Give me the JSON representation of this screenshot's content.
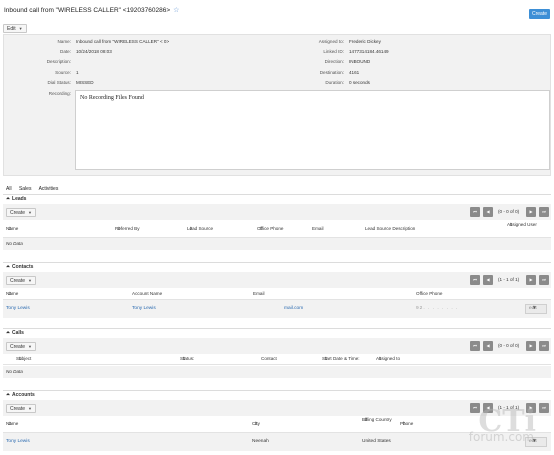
{
  "header": {
    "title": "Inbound call from \"WIRELESS CALLER\" <19203760286>",
    "create_label": "Create"
  },
  "actions": {
    "edit_label": "Edit"
  },
  "detail": {
    "left": [
      {
        "label": "Name:",
        "value": "Inbound call from \"WIRELESS CALLER\" <                    0>"
      },
      {
        "label": "Date:",
        "value": "10/24/2018 08:03"
      },
      {
        "label": "Description:",
        "value": ""
      },
      {
        "label": "Source:",
        "value": "1"
      },
      {
        "label": "Dial Status:",
        "value": "MISSED"
      }
    ],
    "right": [
      {
        "label": "Assigned to:",
        "value": "Frederic Dickey"
      },
      {
        "label": "Linked ID:",
        "value": "1477314184.46149"
      },
      {
        "label": "Direction:",
        "value": "INBOUND"
      },
      {
        "label": "Destination:",
        "value": "4161"
      },
      {
        "label": "Duration:",
        "value": "0 seconds"
      }
    ],
    "recording_label": "Recording:",
    "recording_text": "No Recording Files Found"
  },
  "tabs": [
    "All",
    "Sales",
    "Activities"
  ],
  "subpanels": {
    "leads": {
      "title": "Leads",
      "create_label": "Create",
      "count": "(0 - 0 of 0)",
      "columns": [
        "Name",
        "Referred By",
        "Lead Source",
        "Office Phone",
        "Email",
        "Lead Source Description",
        "Assigned User"
      ],
      "empty_text": "No Data"
    },
    "contacts": {
      "title": "Contacts",
      "create_label": "Create",
      "count": "(1 - 1 of 1)",
      "columns": [
        "Name",
        "Account Name",
        "Email",
        "Office Phone"
      ],
      "row": {
        "name": "Tony Lewis",
        "account": "Tony Lewis",
        "email": "mail.com",
        "phone": "92. . . . . . . .",
        "edit": "edit"
      }
    },
    "calls": {
      "title": "Calls",
      "create_label": "Create",
      "count": "(0 - 0 of 0)",
      "columns": [
        "Subject",
        "Status:",
        "Contact",
        "Start Date & Time:",
        "Assigned to"
      ],
      "empty_text": "No Data"
    },
    "accounts": {
      "title": "Accounts",
      "create_label": "Create",
      "count": "(1 - 1 of 1)",
      "columns": [
        "Name",
        "City",
        "Billing Country",
        "Phone"
      ],
      "row": {
        "name": "Tony Lewis",
        "city": "Neenah",
        "country": "United States",
        "edit": "edit"
      }
    }
  },
  "pager_icons": [
    "first-page-icon",
    "prev-page-icon",
    "next-page-icon",
    "last-page-icon"
  ],
  "watermark": {
    "big": "CTi",
    "small": "forum.com"
  },
  "colors": {
    "accent": "#3d8fd6",
    "link": "#2a6ab0",
    "panel_bg": "#f2f2f2",
    "pager_btn": "#8b8b8b"
  }
}
